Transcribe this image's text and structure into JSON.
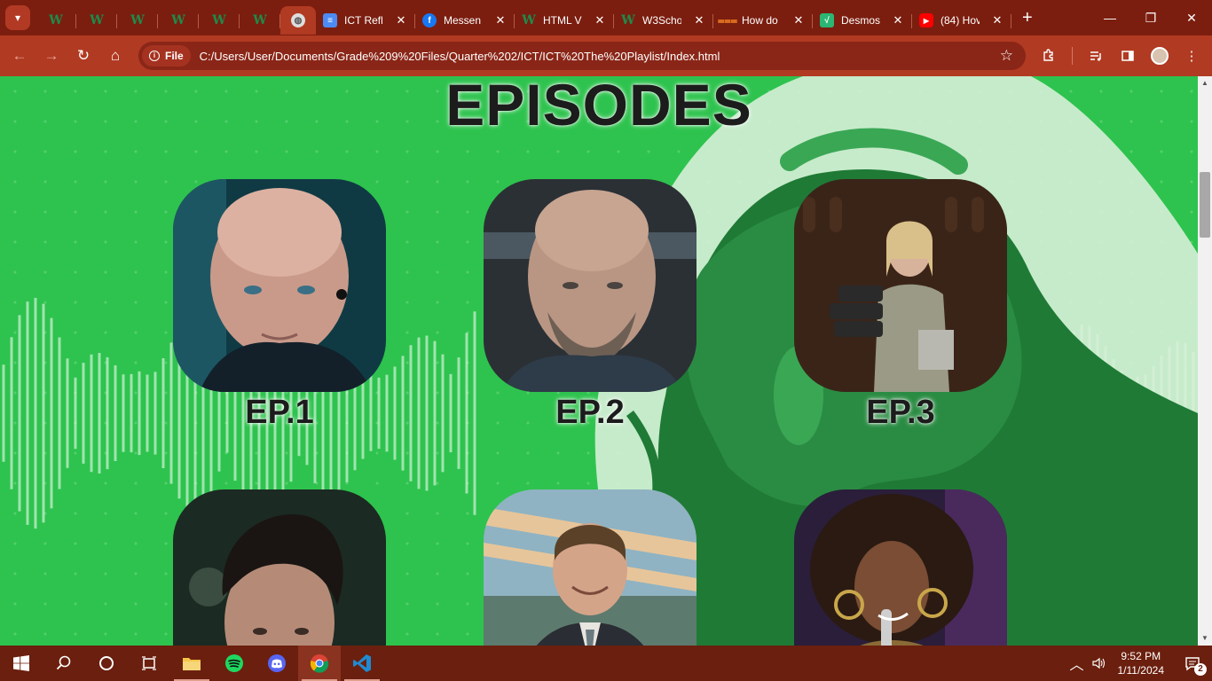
{
  "browser": {
    "tabs": [
      {
        "kind": "pinned",
        "favicon": "w3schools-icon",
        "title": ""
      },
      {
        "kind": "pinned",
        "favicon": "w3schools-icon",
        "title": ""
      },
      {
        "kind": "pinned",
        "favicon": "w3schools-icon",
        "title": ""
      },
      {
        "kind": "pinned",
        "favicon": "w3schools-icon",
        "title": ""
      },
      {
        "kind": "pinned",
        "favicon": "w3schools-icon",
        "title": ""
      },
      {
        "kind": "pinned",
        "favicon": "w3schools-icon",
        "title": ""
      },
      {
        "kind": "active",
        "favicon": "globe-icon",
        "title": ""
      },
      {
        "kind": "normal",
        "favicon": "google-docs-icon",
        "title": "ICT Refl"
      },
      {
        "kind": "normal",
        "favicon": "facebook-icon",
        "title": "Messen"
      },
      {
        "kind": "normal",
        "favicon": "w3schools-icon",
        "title": "HTML V"
      },
      {
        "kind": "normal",
        "favicon": "w3schools-icon",
        "title": "W3Scho"
      },
      {
        "kind": "normal",
        "favicon": "stackoverflow-icon",
        "title": "How do"
      },
      {
        "kind": "normal",
        "favicon": "desmos-icon",
        "title": "Desmos"
      },
      {
        "kind": "normal",
        "favicon": "youtube-icon",
        "title": "(84) Hov"
      }
    ],
    "file_chip": "File",
    "url": "C:/Users/User/Documents/Grade%209%20Files/Quarter%202/ICT/ICT%20The%20Playlist/Index.html"
  },
  "page": {
    "heading": "EPISODES",
    "episodes": [
      {
        "label": "EP.1",
        "image": "bald man with earpiece"
      },
      {
        "label": "EP.2",
        "image": "bald bearded man"
      },
      {
        "label": "EP.3",
        "image": "woman carrying film reels"
      },
      {
        "label": "",
        "image": "dark-haired young man"
      },
      {
        "label": "",
        "image": "smiling man in suit"
      },
      {
        "label": "",
        "image": "singer with microphone"
      }
    ]
  },
  "taskbar": {
    "time": "9:52 PM",
    "date": "1/11/2024",
    "notification_count": "2",
    "apps": [
      "start-icon",
      "search-icon",
      "cortana-icon",
      "task-view-icon",
      "file-explorer-icon",
      "spotify-icon",
      "discord-icon",
      "chrome-icon",
      "vscode-icon"
    ]
  },
  "colors": {
    "page_green": "#2ec34e",
    "chrome_dark": "#7b1e0f",
    "chrome_toolbar": "#b13a22",
    "taskbar": "#6b1f0e"
  }
}
